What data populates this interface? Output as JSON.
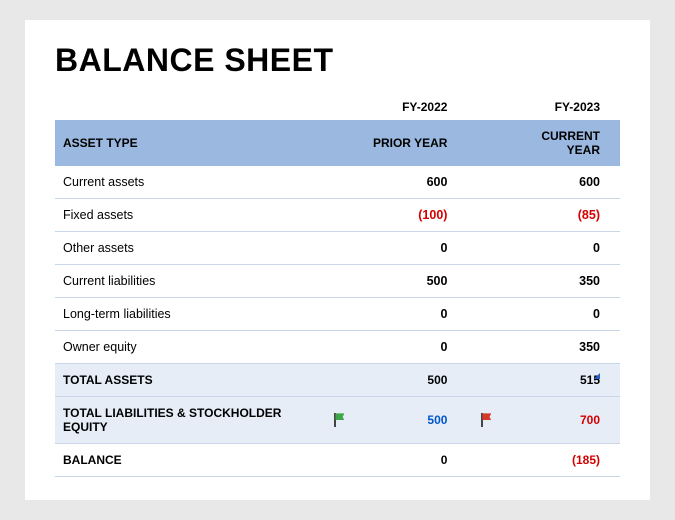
{
  "title": "BALANCE SHEET",
  "years": {
    "prior": "FY-2022",
    "current": "FY-2023"
  },
  "headers": {
    "type": "ASSET TYPE",
    "prior": "PRIOR YEAR",
    "current": "CURRENT YEAR"
  },
  "rows": [
    {
      "label": "Current assets",
      "prior": "600",
      "current": "600",
      "prior_neg": false,
      "current_neg": false
    },
    {
      "label": "Fixed assets",
      "prior": "(100)",
      "current": "(85)",
      "prior_neg": true,
      "current_neg": true
    },
    {
      "label": "Other assets",
      "prior": "0",
      "current": "0",
      "prior_neg": false,
      "current_neg": false
    },
    {
      "label": "Current liabilities",
      "prior": "500",
      "current": "350",
      "prior_neg": false,
      "current_neg": false
    },
    {
      "label": "Long-term liabilities",
      "prior": "0",
      "current": "0",
      "prior_neg": false,
      "current_neg": false
    },
    {
      "label": "Owner equity",
      "prior": "0",
      "current": "350",
      "prior_neg": false,
      "current_neg": false
    }
  ],
  "totals": {
    "assets": {
      "label": "TOTAL ASSETS",
      "prior": "500",
      "current": "515"
    },
    "liab": {
      "label": "TOTAL LIABILITIES & STOCKHOLDER EQUITY",
      "prior": "500",
      "current": "700",
      "prior_flag": "green",
      "prior_class": "pos",
      "current_flag": "red",
      "current_class": "neg"
    },
    "balance": {
      "label": "BALANCE",
      "prior": "0",
      "current": "(185)",
      "current_neg": true
    }
  },
  "chart_data": {
    "type": "table",
    "title": "Balance Sheet",
    "columns": [
      "Asset Type",
      "FY-2022 (Prior Year)",
      "FY-2023 (Current Year)"
    ],
    "rows": [
      [
        "Current assets",
        600,
        600
      ],
      [
        "Fixed assets",
        -100,
        -85
      ],
      [
        "Other assets",
        0,
        0
      ],
      [
        "Current liabilities",
        500,
        350
      ],
      [
        "Long-term liabilities",
        0,
        0
      ],
      [
        "Owner equity",
        0,
        350
      ],
      [
        "TOTAL ASSETS",
        500,
        515
      ],
      [
        "TOTAL LIABILITIES & STOCKHOLDER EQUITY",
        500,
        700
      ],
      [
        "BALANCE",
        0,
        -185
      ]
    ]
  }
}
